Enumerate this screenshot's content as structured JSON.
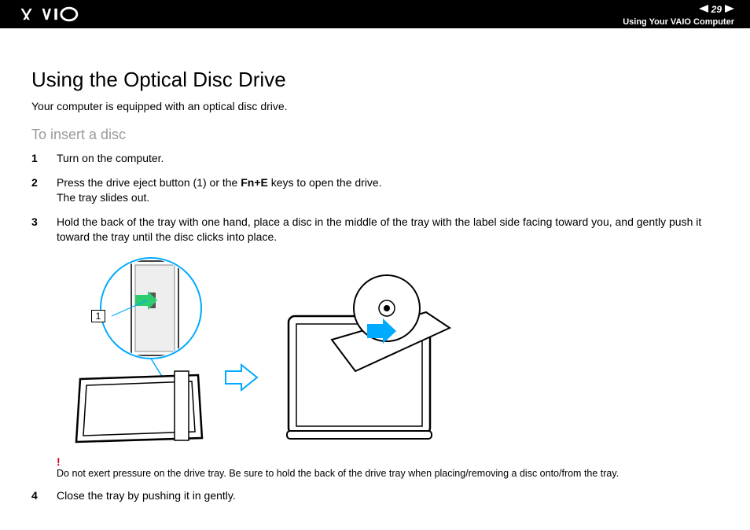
{
  "header": {
    "page_number": "29",
    "section": "Using Your VAIO Computer"
  },
  "content": {
    "title": "Using the Optical Disc Drive",
    "intro": "Your computer is equipped with an optical disc drive.",
    "subheading": "To insert a disc",
    "steps": {
      "s1_num": "1",
      "s1_text": "Turn on the computer.",
      "s2_num": "2",
      "s2_pre": "Press the drive eject button (1) or the ",
      "s2_bold": "Fn+E",
      "s2_post": " keys to open the drive.",
      "s2_line2": "The tray slides out.",
      "s3_num": "3",
      "s3_text": "Hold the back of the tray with one hand, place a disc in the middle of the tray with the label side facing toward you, and gently push it toward the tray until the disc clicks into place.",
      "s4_num": "4",
      "s4_text": "Close the tray by pushing it in gently."
    },
    "callout": "1",
    "warning_mark": "!",
    "warning_text": "Do not exert pressure on the drive tray. Be sure to hold the back of the drive tray when placing/removing a disc onto/from the tray."
  }
}
